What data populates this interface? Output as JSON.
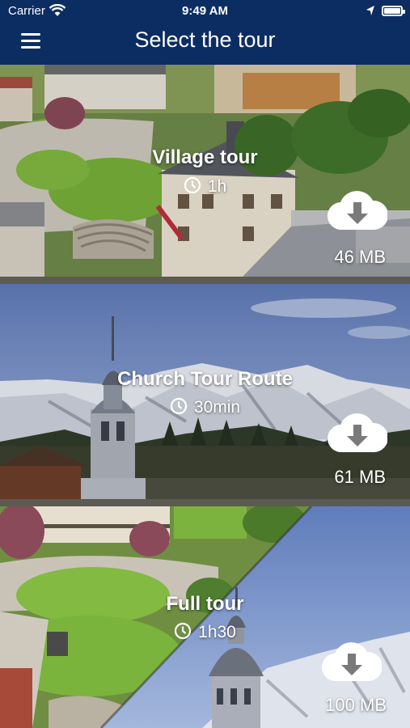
{
  "status_bar": {
    "carrier": "Carrier",
    "time": "9:49 AM"
  },
  "header": {
    "title": "Select the tour"
  },
  "tours": [
    {
      "title": "Village tour",
      "duration": "1h",
      "size": "46 MB"
    },
    {
      "title": "Church Tour Route",
      "duration": "30min",
      "size": "61 MB"
    },
    {
      "title": "Full tour",
      "duration": "1h30",
      "size": "100 MB"
    }
  ],
  "colors": {
    "header": "#0c2d62",
    "divider": "#5b5b52"
  },
  "icons": {
    "menu": "hamburger-menu",
    "duration": "clock",
    "download": "cloud-download"
  }
}
